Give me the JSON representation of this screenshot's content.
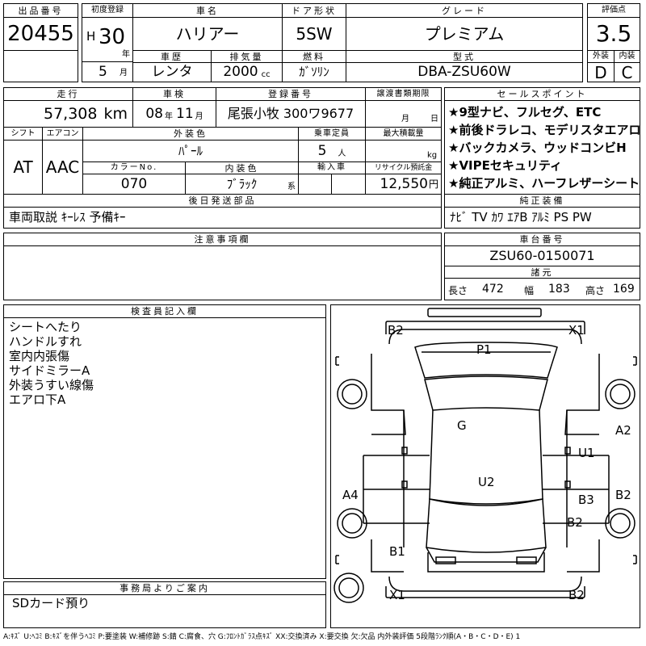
{
  "header": {
    "lot_no_label": "出品番号",
    "lot_no": "20455",
    "first_reg_label": "初度登録",
    "era": "H",
    "year": "30",
    "year_unit": "年",
    "month": "5",
    "month_unit": "月",
    "car_name_label": "車名",
    "car_name": "ハリアー",
    "door_label": "ドア形状",
    "door": "5SW",
    "grade_label": "グレード",
    "grade": "プレミアム",
    "score_label": "評価点",
    "score": "3.5",
    "history_label": "車歴",
    "history": "レンタ",
    "displacement_label": "排気量",
    "displacement": "2000",
    "displacement_unit": "cc",
    "fuel_label": "燃料",
    "fuel": "ｶﾞｿﾘﾝ",
    "model_label": "型式",
    "model": "DBA-ZSU60W",
    "exterior_label": "外装",
    "exterior": "D",
    "interior_label": "内装",
    "interior": "C"
  },
  "row2": {
    "mileage_label": "走行",
    "mileage": "57,308",
    "mileage_unit": "km",
    "inspection_label": "車検",
    "insp_year": "08",
    "insp_year_unit": "年",
    "insp_month": "11",
    "insp_month_unit": "月",
    "plate_label": "登録番号",
    "plate": "尾張小牧 300ワ9677",
    "transfer_label": "譲渡書類期限",
    "transfer_month_unit": "月",
    "transfer_day_unit": "日",
    "selling_label": "セールスポイント",
    "selling_points": [
      "★9型ナビ、フルセグ、ETC",
      "★前後ドラレコ、モデリスタエアロ",
      "★バックカメラ、ウッドコンビH",
      "★VIPEセキュリティ",
      "★純正アルミ、ハーフレザーシート"
    ]
  },
  "row3": {
    "shift_label": "シフト",
    "shift": "AT",
    "ac_label": "エアコン",
    "ac": "AAC",
    "ext_color_label": "外装色",
    "ext_color": "ﾊﾟｰﾙ",
    "capacity_label": "乗車定員",
    "capacity": "5",
    "capacity_unit": "人",
    "load_label": "最大積載量",
    "load_unit": "kg",
    "color_no_label": "カラーNo.",
    "color_no": "070",
    "int_color_label": "内装色",
    "int_color": "ﾌﾞﾗｯｸ",
    "int_color_unit": "系",
    "import_label": "輸入車",
    "recycle_label": "リサイクル預託金",
    "recycle": "12,550",
    "recycle_unit": "円"
  },
  "later_parts": {
    "label": "後日発送部品",
    "value": "車両取説 ｷｰﾚｽ 予備ｷｰ"
  },
  "equipment": {
    "label": "純正装備",
    "value": "ﾅﾋﾞ TV ｶﾜ ｴｱB ｱﾙﾐ PS PW"
  },
  "notes": {
    "label": "注意事項欄"
  },
  "chassis": {
    "label": "車台番号",
    "value": "ZSU60-0150071"
  },
  "dims": {
    "label": "諸元",
    "length_label": "長さ",
    "length": "472",
    "width_label": "幅",
    "width": "183",
    "height_label": "高さ",
    "height": "169"
  },
  "inspector": {
    "label": "検査員記入欄",
    "lines": [
      "シートへたり",
      "ハンドルすれ",
      "室内内張傷",
      "サイドミラーA",
      "外装うすい線傷",
      "エアロ下A"
    ]
  },
  "office": {
    "label": "事務局よりご案内",
    "value": "SDカード預り"
  },
  "diagram": {
    "marks": [
      "B2",
      "X1",
      "P1",
      "A2",
      "G",
      "U1",
      "U2",
      "A4",
      "B3",
      "B2",
      "B2",
      "B1",
      "X1",
      "B2"
    ]
  },
  "legend": "A:ｷｽﾞ U:ﾍｺﾐ B:ｷｽﾞを伴うﾍｺﾐ P:要塗装 W:補修跡 S:錆 C:腐食、穴 G:ﾌﾛﾝﾄｶﾞﾗｽ点ｷｽﾞ XX:交換済み X:要交換 欠:欠品 内外装評価 5段階ﾗﾝｸ順(A・B・C・D・E) 1"
}
